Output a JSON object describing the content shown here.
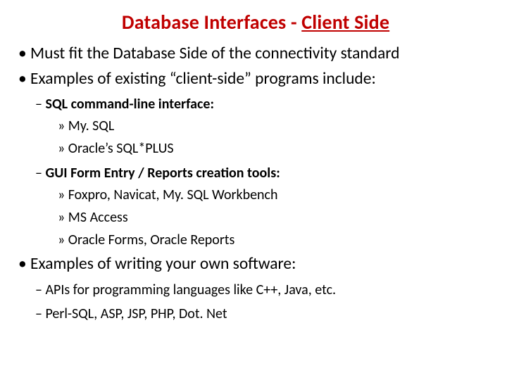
{
  "title_plain": "Database Interfaces - ",
  "title_underlined": "Client Side",
  "bullets": {
    "b1": "Must fit the Database Side of the connectivity standard",
    "b2": "Examples of existing “client-side” programs include:",
    "b2_1": "SQL command-line interface:",
    "b2_1_1": "My. SQL",
    "b2_1_2": "Oracle’s SQL*PLUS",
    "b2_2": "GUI Form Entry / Reports creation tools:",
    "b2_2_1": "Foxpro, Navicat, My. SQL Workbench",
    "b2_2_2": "MS Access",
    "b2_2_3": "Oracle Forms, Oracle Reports",
    "b3": "Examples of writing your own software:",
    "b3_1": "APIs for programming languages like C++, Java, etc.",
    "b3_2": "Perl-SQL, ASP, JSP, PHP, Dot. Net"
  }
}
